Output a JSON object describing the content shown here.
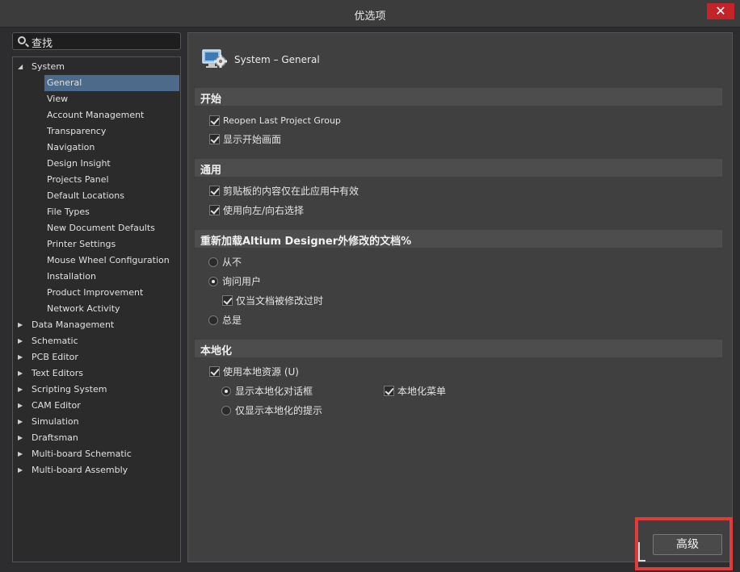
{
  "window": {
    "title": "优选项",
    "close_label": "✕"
  },
  "search": {
    "text": "查找"
  },
  "tree": {
    "system_label": "System",
    "system_children": [
      "General",
      "View",
      "Account Management",
      "Transparency",
      "Navigation",
      "Design Insight",
      "Projects Panel",
      "Default Locations",
      "File Types",
      "New Document Defaults",
      "Printer Settings",
      "Mouse Wheel Configuration",
      "Installation",
      "Product Improvement",
      "Network Activity"
    ],
    "selected": "General",
    "other_groups": [
      "Data Management",
      "Schematic",
      "PCB Editor",
      "Text Editors",
      "Scripting System",
      "CAM Editor",
      "Simulation",
      "Draftsman",
      "Multi-board Schematic",
      "Multi-board Assembly"
    ]
  },
  "panel": {
    "title": "System – General",
    "icon": "system-settings-icon",
    "sections": {
      "start": {
        "heading": "开始",
        "options": [
          {
            "label": "Reopen Last Project Group",
            "checked": true
          },
          {
            "label": "显示开始画面",
            "checked": true
          }
        ]
      },
      "general": {
        "heading": "通用",
        "options": [
          {
            "label": "剪贴板的内容仅在此应用中有效",
            "checked": true
          },
          {
            "label": "使用向左/向右选择",
            "checked": true
          }
        ]
      },
      "reload": {
        "heading": "重新加载Altium Designer外修改的文档%",
        "never": "从不",
        "ask_user": "询问用户",
        "only_modified": "仅当文档被修改过时",
        "always": "总是",
        "selected": "询问用户"
      },
      "localization": {
        "heading": "本地化",
        "use_local": "使用本地资源 (U)",
        "show_dialogs": "显示本地化对话框",
        "local_menu": "本地化菜单",
        "hints_only": "仅显示本地化的提示"
      }
    }
  },
  "buttons": {
    "advanced": "高级"
  },
  "colors": {
    "accent_selected": "#4c6a8a",
    "highlight": "#e53a3a",
    "close": "#c5232a"
  }
}
